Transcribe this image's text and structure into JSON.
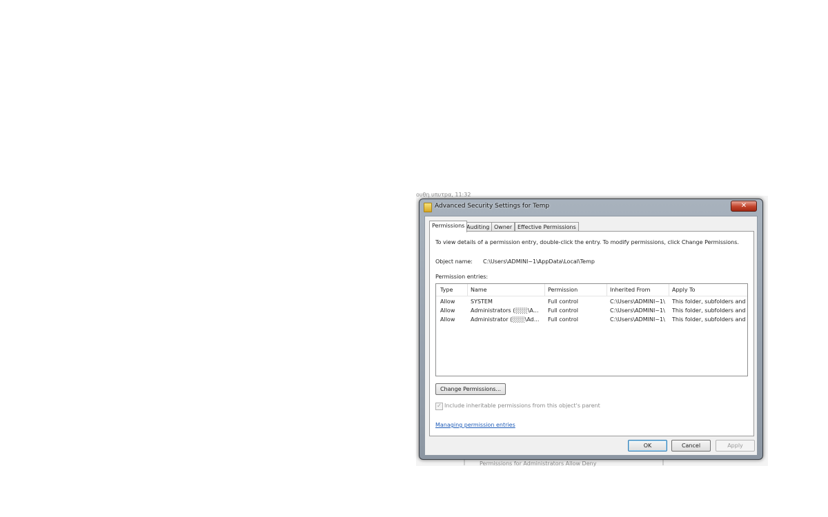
{
  "background": {
    "timestamp": "ουθη υπυτpα, 11:32",
    "fragment_bottom": "Permissions for Administrators   Allow   Deny"
  },
  "dialog": {
    "title": "Advanced Security Settings for Temp",
    "close_label": "✕",
    "tabs": [
      "Permissions",
      "Auditing",
      "Owner",
      "Effective Permissions"
    ],
    "info_text": "To view details of a permission entry, double-click the entry. To modify permissions, click Change Permissions.",
    "object_name_label": "Object name:",
    "object_name_value": "C:\\Users\\ADMINI~1\\AppData\\Local\\Temp",
    "entries_label": "Permission entries:",
    "columns": [
      "Type",
      "Name",
      "Permission",
      "Inherited From",
      "Apply To"
    ],
    "rows": [
      {
        "type": "Allow",
        "name": "SYSTEM",
        "permission": "Full control",
        "inherited_from": "C:\\Users\\ADMINI~1\\",
        "apply_to": "This folder, subfolders and..."
      },
      {
        "type": "Allow",
        "name": "Administrators (░░░\\A...",
        "permission": "Full control",
        "inherited_from": "C:\\Users\\ADMINI~1\\",
        "apply_to": "This folder, subfolders and..."
      },
      {
        "type": "Allow",
        "name": "Administrator (░░░\\Ad...",
        "permission": "Full control",
        "inherited_from": "C:\\Users\\ADMINI~1\\",
        "apply_to": "This folder, subfolders and..."
      }
    ],
    "change_permissions_label": "Change Permissions...",
    "inherit_checkbox_label": "Include inheritable permissions from this object's parent",
    "inherit_checked": true,
    "link_label": "Managing permission entries",
    "ok_label": "OK",
    "cancel_label": "Cancel",
    "apply_label": "Apply"
  }
}
